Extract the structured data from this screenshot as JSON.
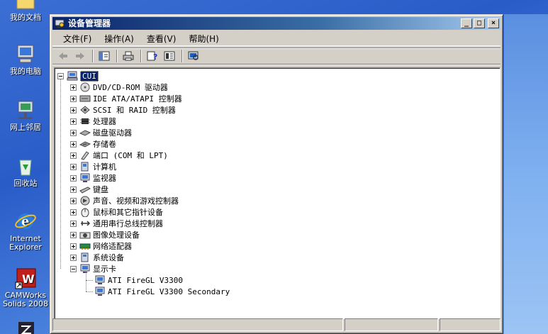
{
  "desktop": {
    "icons": [
      {
        "name": "my-documents",
        "label": "我的文档"
      },
      {
        "name": "my-computer",
        "label": "我的电脑"
      },
      {
        "name": "network-places",
        "label": "网上邻居"
      },
      {
        "name": "recycle-bin",
        "label": "回收站"
      },
      {
        "name": "internet-explorer",
        "label": "Internet Explorer"
      },
      {
        "name": "camworks",
        "label": "CAMWorks Solids 2008"
      }
    ]
  },
  "window": {
    "title": "设备管理器",
    "buttons": {
      "minimize": "_",
      "maximize": "□",
      "close": "×"
    },
    "menu": [
      "文件(F)",
      "操作(A)",
      "查看(V)",
      "帮助(H)"
    ],
    "toolbar_icons": [
      "back-arrow-icon",
      "forward-arrow-icon",
      "show-hide-tree-icon",
      "print-icon",
      "help-icon",
      "properties-icon",
      "scan-hardware-icon"
    ],
    "tree": {
      "root": "CUI",
      "categories": [
        "DVD/CD-ROM 驱动器",
        "IDE ATA/ATAPI 控制器",
        "SCSI 和 RAID 控制器",
        "处理器",
        "磁盘驱动器",
        "存储卷",
        "端口 (COM 和 LPT)",
        "计算机",
        "监视器",
        "键盘",
        "声音、视频和游戏控制器",
        "鼠标和其它指针设备",
        "通用串行总线控制器",
        "图像处理设备",
        "网络适配器",
        "系统设备",
        "显示卡"
      ],
      "expanded_children": [
        "ATI FireGL V3300",
        "ATI FireGL V3300 Secondary"
      ]
    }
  }
}
